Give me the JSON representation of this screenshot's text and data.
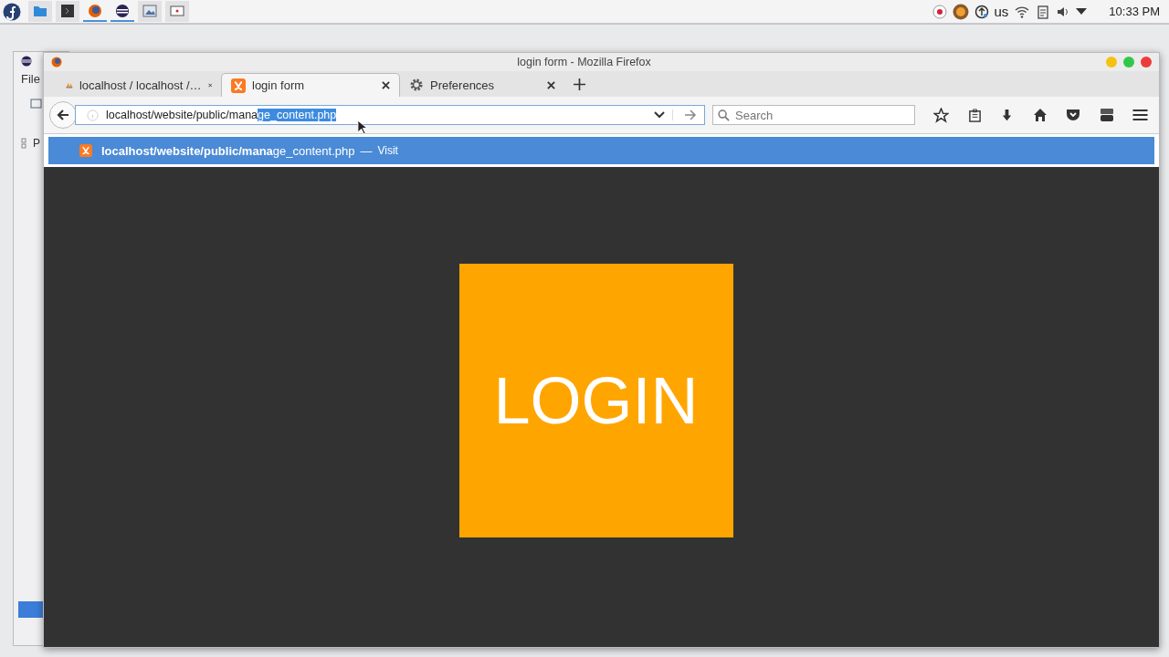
{
  "panel": {
    "launchers": [
      {
        "kind": "files",
        "running": false
      },
      {
        "kind": "terminal",
        "running": false
      },
      {
        "kind": "firefox",
        "running": true
      },
      {
        "kind": "eclipse",
        "running": true
      },
      {
        "kind": "image",
        "running": false
      },
      {
        "kind": "screen",
        "running": false
      }
    ],
    "keyboard_layout": "us",
    "clock": "10:33 PM"
  },
  "background_window": {
    "menu": "File",
    "sidebar_label": "P"
  },
  "browser": {
    "title": "login form - Mozilla Firefox",
    "tabs": [
      {
        "label": "localhost / localhost /…",
        "kind": "pma",
        "selected": false
      },
      {
        "label": "login form",
        "kind": "xampp",
        "selected": true
      },
      {
        "label": "Preferences",
        "kind": "gear",
        "selected": false
      }
    ],
    "url": {
      "typed": "localhost/website/public/mana",
      "completed": "ge_content.php"
    },
    "search": {
      "placeholder": "Search"
    },
    "suggestion": {
      "bold": "localhost/website/public/mana",
      "rest": "ge_content.php",
      "separator": "—",
      "action": "Visit",
      "selected": true
    },
    "page": {
      "button": "LOGIN"
    }
  }
}
